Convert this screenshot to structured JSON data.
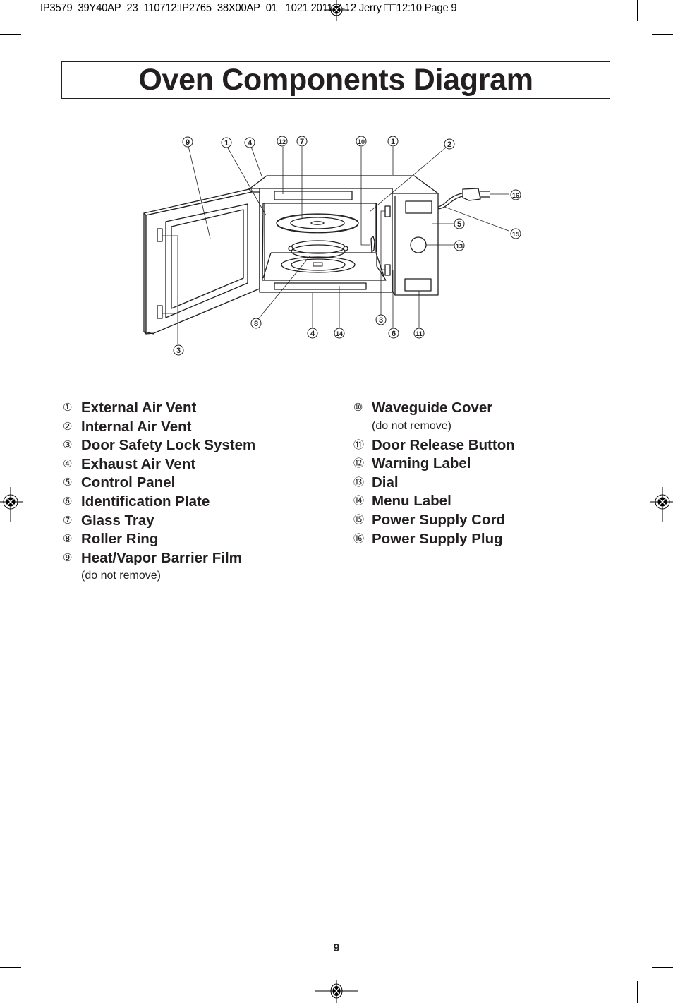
{
  "slug": {
    "text": "IP3579_39Y40AP_23_110712:IP2765_38X00AP_01_  1021  2011-7-12  Jerry □□12:10  Page 9"
  },
  "title": "Oven Components Diagram",
  "diagram": {
    "callouts": {
      "c9": "9",
      "c1a": "1",
      "c4a": "4",
      "c12": "12",
      "c7": "7",
      "c10": "10",
      "c1b": "1",
      "c2": "2",
      "c16": "16",
      "c5": "5",
      "c15": "15",
      "c13": "13",
      "c8": "8",
      "c4b": "4",
      "c14": "14",
      "c3b": "3",
      "c6": "6",
      "c11": "11",
      "c3a": "3"
    }
  },
  "legend": {
    "left": [
      {
        "num": "①",
        "label": "External Air Vent"
      },
      {
        "num": "②",
        "label": "Internal Air Vent"
      },
      {
        "num": "③",
        "label": "Door Safety Lock System"
      },
      {
        "num": "④",
        "label": "Exhaust Air Vent"
      },
      {
        "num": "⑤",
        "label": "Control Panel"
      },
      {
        "num": "⑥",
        "label": "Identification Plate"
      },
      {
        "num": "⑦",
        "label": "Glass Tray"
      },
      {
        "num": "⑧",
        "label": "Roller Ring"
      },
      {
        "num": "⑨",
        "label": "Heat/Vapor Barrier Film",
        "note": "(do not remove)"
      }
    ],
    "right": [
      {
        "num": "⑩",
        "label": "Waveguide Cover",
        "note": "(do not remove)"
      },
      {
        "num": "⑪",
        "label": "Door Release Button"
      },
      {
        "num": "⑫",
        "label": "Warning Label"
      },
      {
        "num": "⑬",
        "label": "Dial"
      },
      {
        "num": "⑭",
        "label": "Menu Label"
      },
      {
        "num": "⑮",
        "label": "Power Supply Cord"
      },
      {
        "num": "⑯",
        "label": "Power Supply Plug"
      }
    ]
  },
  "footer": {
    "page_number": "9"
  }
}
